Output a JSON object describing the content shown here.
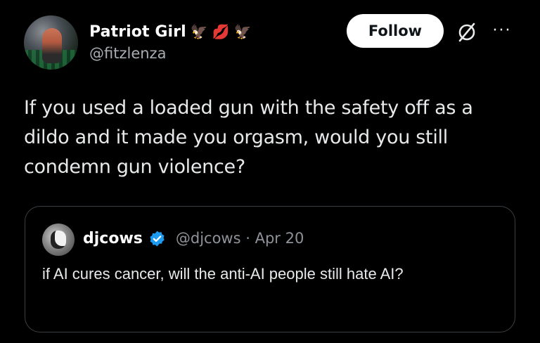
{
  "author": {
    "display_name": "Patriot Girl",
    "emojis": [
      "🦅",
      "💋",
      "🦅"
    ],
    "handle": "@fitzlenza"
  },
  "actions": {
    "follow_label": "Follow",
    "grok_icon": "circle-slash-icon",
    "more_icon": "more-horizontal-icon",
    "more_label": "···"
  },
  "tweet": {
    "text": "If you used a loaded gun with the safety off as a dildo and it made you orgasm, would you still condemn gun violence?"
  },
  "quoted_tweet": {
    "display_name": "djcows",
    "verified": true,
    "verified_color": "#1d9bf0",
    "meta": "@djcows · Apr 20",
    "text": "if AI cures cancer, will the anti-AI people still hate AI?"
  },
  "colors": {
    "background": "#000000",
    "text": "#e7e9ea",
    "secondary_text": "#8e9399",
    "follow_button_bg": "#ffffff"
  }
}
